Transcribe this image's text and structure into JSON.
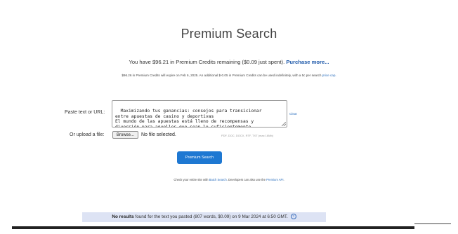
{
  "page": {
    "title": "Premium Search"
  },
  "credits": {
    "text_before": "You have $96.21 in Premium Credits remaining ($0.09 just spent).",
    "purchase_link": "Purchase more..."
  },
  "expire": {
    "text": "$96.26 in Premium Credits will expire on Feb 6, 2025. An additional $-0.05 in Premium Credits can be used indefinitely, with a 5c per search",
    "link": "price cap."
  },
  "form": {
    "paste_label": "Paste text or URL:",
    "textarea_value": "Maximizando tus ganancias: consejos para transicionar\nentre apuestas de casino y deportivas\nEl mundo de las apuestas está lleno de recompensas y\ndiversión para aquellos que sean lo suficientemente",
    "clear_link": "Clear",
    "upload_label": "Or upload a file:",
    "browse_label": "Browse...",
    "no_file_text": "No file selected.",
    "formats_text": "PDF, DOC, DOCX, RTF, TXT (max 16Mb)",
    "search_button": "Premium Search"
  },
  "batch": {
    "t1": "Check your entire site with",
    "link1": "Batch Search",
    "t2": ". Developers can also use the",
    "link2": "Premium API",
    "t3": "."
  },
  "results": {
    "bold": "No results",
    "text": "found for the text you pasted (807 words, $0.09) on 9 Mar 2024 at 6:50 GMT.",
    "help_icon": "?"
  },
  "colors": {
    "accent": "#1e78d2",
    "link": "#2a6ebd",
    "results_bg": "#dde3f4"
  }
}
